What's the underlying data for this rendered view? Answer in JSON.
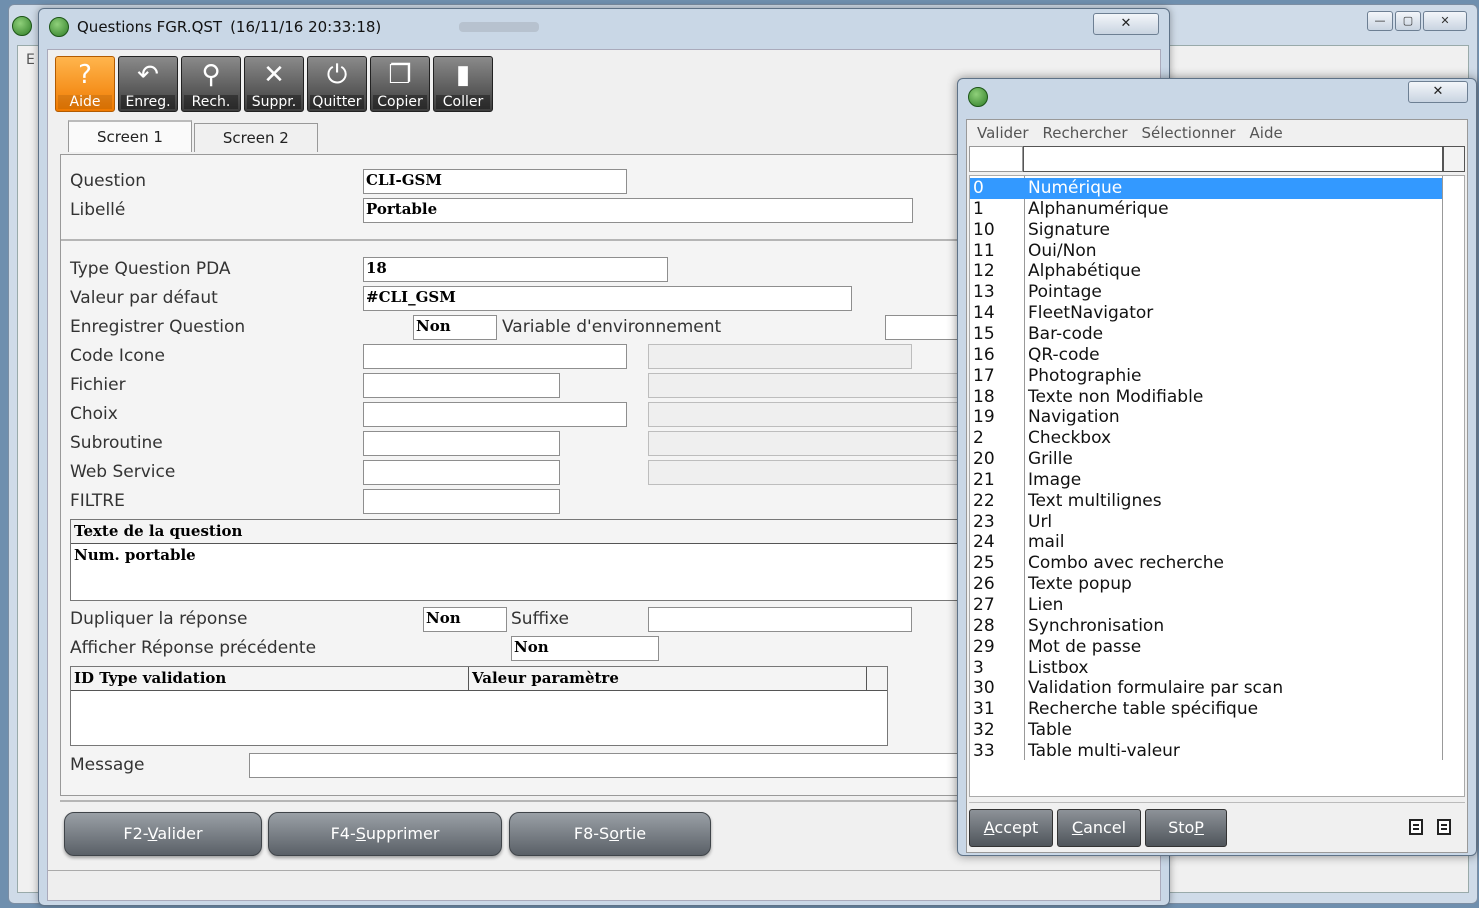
{
  "background_window": {
    "edge_letter": "E",
    "controls": {
      "minimize": "—",
      "maximize": "▢",
      "close": "✕"
    }
  },
  "main_window": {
    "title": "Questions FGR.QST",
    "timestamp": "(16/11/16 20:33:18)",
    "close": "✕"
  },
  "toolbar": [
    {
      "label": "Aide",
      "icon": "help-icon",
      "glyph": "?"
    },
    {
      "label": "Enreg.",
      "icon": "undo-save-icon",
      "glyph": "↶"
    },
    {
      "label": "Rech.",
      "icon": "search-icon",
      "glyph": "⚲"
    },
    {
      "label": "Suppr.",
      "icon": "delete-icon",
      "glyph": "✕"
    },
    {
      "label": "Quitter",
      "icon": "power-icon",
      "glyph": "⏻"
    },
    {
      "label": "Copier",
      "icon": "copy-icon",
      "glyph": "❐"
    },
    {
      "label": "Coller",
      "icon": "paste-icon",
      "glyph": "▮"
    }
  ],
  "tabs": [
    "Screen 1",
    "Screen 2"
  ],
  "form": {
    "question_label": "Question",
    "question_value": "CLI-GSM",
    "libelle_label": "Libellé",
    "libelle_value": "Portable",
    "type_label": "Type Question PDA",
    "type_value": "18",
    "default_label": "Valeur par défaut",
    "default_value": "#CLI_GSM",
    "save_label": "Enregistrer Question",
    "save_value": "Non",
    "env_label": "Variable d'environnement",
    "env_value": "",
    "icon_label": "Code Icone",
    "icon_value": "",
    "file_label": "Fichier",
    "file_value": "",
    "choice_label": "Choix",
    "choice_value": "",
    "sub_label": "Subroutine",
    "sub_value": "",
    "ws_label": "Web Service",
    "ws_value": "",
    "filter_label": "FILTRE",
    "filter_value": "",
    "text_header": "Texte de la question",
    "text_value": "Num. portable",
    "dup_label": "Dupliquer la réponse",
    "dup_value": "Non",
    "suffix_label": "Suffixe",
    "suffix_value": "",
    "prev_label": "Afficher Réponse précédente",
    "prev_value": "Non",
    "grid_col1": "ID Type validation",
    "grid_col2": "Valeur paramètre",
    "message_label": "Message",
    "message_value": ""
  },
  "buttons": {
    "validate_pre": "F2-",
    "validate_u": "V",
    "validate_post": "alider",
    "delete_pre": "F4-",
    "delete_u": "S",
    "delete_post": "upprimer",
    "exit_pre": "F8-S",
    "exit_u": "o",
    "exit_post": "rtie"
  },
  "lookup": {
    "close": "✕",
    "menu": [
      "Valider",
      "Rechercher",
      "Sélectionner",
      "Aide"
    ],
    "search_value": "",
    "items": [
      {
        "code": "0",
        "name": "Numérique",
        "selected": true
      },
      {
        "code": "1",
        "name": "Alphanumérique"
      },
      {
        "code": "10",
        "name": "Signature"
      },
      {
        "code": "11",
        "name": "Oui/Non"
      },
      {
        "code": "12",
        "name": "Alphabétique"
      },
      {
        "code": "13",
        "name": "Pointage"
      },
      {
        "code": "14",
        "name": "FleetNavigator"
      },
      {
        "code": "15",
        "name": "Bar-code"
      },
      {
        "code": "16",
        "name": "QR-code"
      },
      {
        "code": "17",
        "name": "Photographie"
      },
      {
        "code": "18",
        "name": "Texte non Modifiable"
      },
      {
        "code": "19",
        "name": "Navigation"
      },
      {
        "code": "2",
        "name": "Checkbox"
      },
      {
        "code": "20",
        "name": "Grille"
      },
      {
        "code": "21",
        "name": "Image"
      },
      {
        "code": "22",
        "name": "Text multilignes"
      },
      {
        "code": "23",
        "name": "Url"
      },
      {
        "code": "24",
        "name": "mail"
      },
      {
        "code": "25",
        "name": "Combo avec recherche"
      },
      {
        "code": "26",
        "name": "Texte popup"
      },
      {
        "code": "27",
        "name": "Lien"
      },
      {
        "code": "28",
        "name": "Synchronisation"
      },
      {
        "code": "29",
        "name": "Mot de passe"
      },
      {
        "code": "3",
        "name": "Listbox"
      },
      {
        "code": "30",
        "name": "Validation formulaire par scan"
      },
      {
        "code": "31",
        "name": "Recherche table spécifique"
      },
      {
        "code": "32",
        "name": "Table"
      },
      {
        "code": "33",
        "name": "Table multi-valeur"
      }
    ],
    "accept_u": "A",
    "accept_rest": "ccept",
    "cancel_u": "C",
    "cancel_rest": "ancel",
    "stop_pre": "Sto",
    "stop_u": "P"
  },
  "colors": {
    "selection": "#3399ff",
    "help_button": "#f39200",
    "window_frame": "#c9d7e6"
  }
}
